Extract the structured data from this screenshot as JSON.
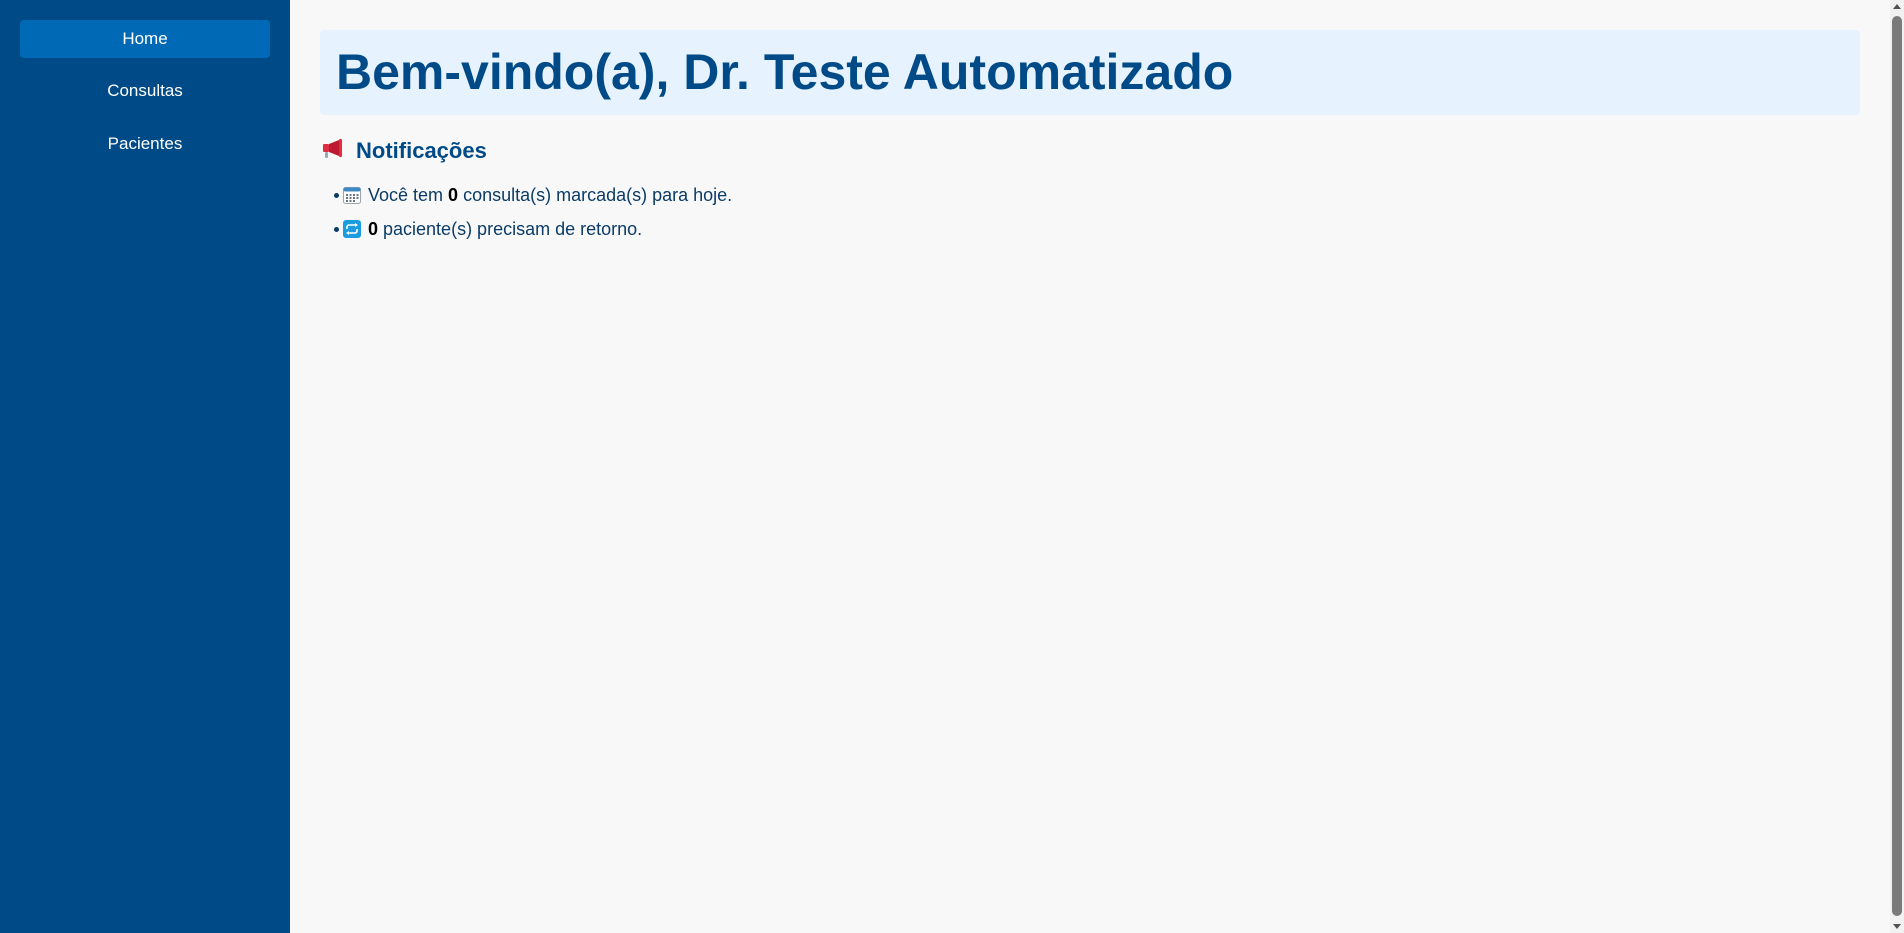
{
  "sidebar": {
    "items": [
      {
        "label": "Home",
        "active": true
      },
      {
        "label": "Consultas",
        "active": false
      },
      {
        "label": "Pacientes",
        "active": false
      }
    ]
  },
  "welcome": {
    "title": "Bem-vindo(a), Dr. Teste Automatizado"
  },
  "notifications": {
    "heading": "Notificações",
    "heading_icon": "megaphone-icon",
    "items": [
      {
        "icon": "calendar-icon",
        "prefix": "Você tem ",
        "count": "0",
        "suffix": " consulta(s) marcada(s) para hoje."
      },
      {
        "icon": "repeat-icon",
        "prefix": "",
        "count": "0",
        "suffix": " paciente(s) precisam de retorno."
      }
    ]
  },
  "colors": {
    "sidebar_bg": "#004b87",
    "active_item_bg": "#0069b6",
    "welcome_bg": "#e6f2fe",
    "title_text": "#004b87"
  }
}
